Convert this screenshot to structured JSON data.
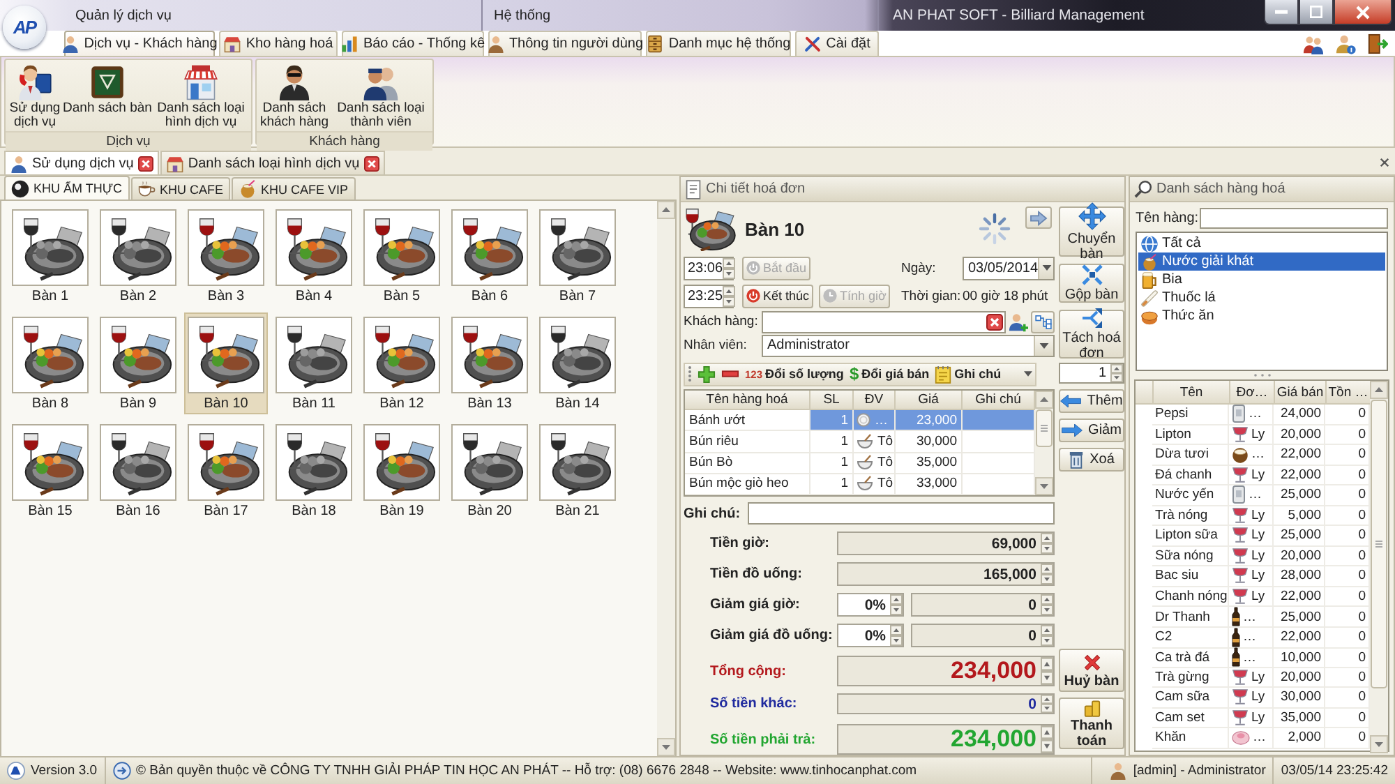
{
  "window": {
    "logo": "AP",
    "title": "AN PHAT SOFT - Billiard Management"
  },
  "tab_groups": [
    {
      "label": "Quản lý dịch vụ"
    },
    {
      "label": "Hệ thống"
    }
  ],
  "ribbon_tabs": [
    {
      "label": "Dịch vụ - Khách hàng",
      "selected": true
    },
    {
      "label": "Kho hàng hoá",
      "selected": false
    },
    {
      "label": "Báo cáo - Thống kê",
      "selected": false
    },
    {
      "label": "Thông tin người dùng",
      "selected": false
    },
    {
      "label": "Danh mục hệ thống",
      "selected": false
    },
    {
      "label": "Cài đặt",
      "selected": false
    }
  ],
  "ribbon_groups": [
    {
      "label": "Dịch vụ",
      "buttons": [
        "Sử dụng dịch vụ",
        "Danh sách bàn",
        "Danh sách loại hình dịch vụ"
      ]
    },
    {
      "label": "Khách hàng",
      "buttons": [
        "Danh sách khách hàng",
        "Danh sách loại thành viên"
      ]
    }
  ],
  "document_tabs": [
    {
      "label": "Sử dụng dịch vụ",
      "selected": true
    },
    {
      "label": "Danh sách loại hình dịch vụ",
      "selected": false
    }
  ],
  "area_tabs": [
    {
      "label": "KHU ẨM THỰC",
      "selected": true
    },
    {
      "label": "KHU CAFE",
      "selected": false
    },
    {
      "label": "KHU CAFE VIP",
      "selected": false
    }
  ],
  "tables": [
    {
      "name": "Bàn 1",
      "occupied": false,
      "selected": false
    },
    {
      "name": "Bàn 2",
      "occupied": false,
      "selected": false
    },
    {
      "name": "Bàn 3",
      "occupied": true,
      "selected": false
    },
    {
      "name": "Bàn 4",
      "occupied": true,
      "selected": false
    },
    {
      "name": "Bàn 5",
      "occupied": true,
      "selected": false
    },
    {
      "name": "Bàn 6",
      "occupied": true,
      "selected": false
    },
    {
      "name": "Bàn 7",
      "occupied": false,
      "selected": false
    },
    {
      "name": "Bàn 8",
      "occupied": true,
      "selected": false
    },
    {
      "name": "Bàn 9",
      "occupied": true,
      "selected": false
    },
    {
      "name": "Bàn 10",
      "occupied": true,
      "selected": true
    },
    {
      "name": "Bàn 11",
      "occupied": false,
      "selected": false
    },
    {
      "name": "Bàn 12",
      "occupied": true,
      "selected": false
    },
    {
      "name": "Bàn 13",
      "occupied": true,
      "selected": false
    },
    {
      "name": "Bàn 14",
      "occupied": false,
      "selected": false
    },
    {
      "name": "Bàn 15",
      "occupied": true,
      "selected": false
    },
    {
      "name": "Bàn 16",
      "occupied": false,
      "selected": false
    },
    {
      "name": "Bàn 17",
      "occupied": true,
      "selected": false
    },
    {
      "name": "Bàn 18",
      "occupied": false,
      "selected": false
    },
    {
      "name": "Bàn 19",
      "occupied": true,
      "selected": false
    },
    {
      "name": "Bàn 20",
      "occupied": false,
      "selected": false
    },
    {
      "name": "Bàn 21",
      "occupied": false,
      "selected": false
    }
  ],
  "invoice": {
    "title": "Chi tiết hoá đơn",
    "table": "Bàn 10",
    "start_time": "23:06",
    "start_button": {
      "label": "Bắt đầu",
      "disabled": true
    },
    "end_time": "23:25",
    "end_button": {
      "label": "Kết thúc",
      "disabled": false
    },
    "timer_button": {
      "label": "Tính giờ",
      "disabled": true
    },
    "date_label": "Ngày:",
    "date": "03/05/2014",
    "duration_label": "Thời gian:",
    "duration": "00 giờ 18 phút",
    "customer_label": "Khách hàng:",
    "staff_label": "Nhân viên:",
    "staff": "Administrator",
    "toolbar": [
      {
        "kind": "add"
      },
      {
        "kind": "remove"
      },
      {
        "kind": "quantity",
        "icon_text": "123",
        "label": "Đổi số lượng"
      },
      {
        "kind": "price",
        "icon_text": "$",
        "label": "Đổi giá bán"
      },
      {
        "kind": "note",
        "label": "Ghi chú"
      }
    ],
    "columns": [
      "Tên hàng hoá",
      "SL",
      "ĐV",
      "Giá",
      "Ghi chú"
    ],
    "items": [
      {
        "name": "Bánh ướt",
        "qty": "1",
        "kind": "plate",
        "unit": "…",
        "price": "23,000",
        "selected": true
      },
      {
        "name": "Bún riêu",
        "qty": "1",
        "kind": "bowl",
        "unit": "Tô",
        "price": "30,000",
        "selected": false
      },
      {
        "name": "Bún Bò",
        "qty": "1",
        "kind": "bowl",
        "unit": "Tô",
        "price": "35,000",
        "selected": false
      },
      {
        "name": "Bún mộc giò heo",
        "qty": "1",
        "kind": "bowl",
        "unit": "Tô",
        "price": "33,000",
        "selected": false
      }
    ],
    "note_label": "Ghi chú:",
    "totals": [
      {
        "kind": "amount",
        "label": "Tiền giờ:",
        "value": "69,000"
      },
      {
        "kind": "amount",
        "label": "Tiền đồ uống:",
        "value": "165,000"
      },
      {
        "kind": "discount",
        "label": "Giảm giá giờ:",
        "percent": "0%",
        "value": "0"
      },
      {
        "kind": "discount",
        "label": "Giảm giá đồ uống:",
        "percent": "0%",
        "value": "0"
      },
      {
        "kind": "grand",
        "label": "Tổng cộng:",
        "value": "234,000",
        "color": "#b3181c"
      },
      {
        "kind": "extra",
        "label": "Số tiền khác:",
        "value": "0",
        "color": "#1f2a9e"
      },
      {
        "kind": "grand",
        "label": "Số tiền phải trả:",
        "value": "234,000",
        "color": "#22a631"
      }
    ],
    "action_buttons": [
      "Chuyển bàn",
      "Gộp bàn",
      "Tách hoá đơn"
    ],
    "quantity": "1",
    "item_buttons": [
      "Thêm",
      "Giảm",
      "Xoá"
    ],
    "cancel_button": "Huỷ bàn",
    "pay_button": "Thanh toán"
  },
  "products": {
    "title": "Danh sách hàng hoá",
    "search_label": "Tên hàng:",
    "categories": [
      {
        "label": "Tất cả",
        "selected": false
      },
      {
        "label": "Nước giải khát",
        "selected": true
      },
      {
        "label": "Bia",
        "selected": false
      },
      {
        "label": "Thuốc lá",
        "selected": false
      },
      {
        "label": "Thức ăn",
        "selected": false
      }
    ],
    "columns": [
      "Tên",
      "Đơ…",
      "Giá bán",
      "Tồn …"
    ],
    "rows": [
      {
        "name": "Pepsi",
        "kind": "can",
        "unit": "…",
        "price": "24,000",
        "stock": "0"
      },
      {
        "name": "Lipton",
        "kind": "glass",
        "unit": "Ly",
        "price": "20,000",
        "stock": "0"
      },
      {
        "name": "Dừa tươi",
        "kind": "coconut",
        "unit": "…",
        "price": "22,000",
        "stock": "0"
      },
      {
        "name": "Đá chanh",
        "kind": "glass",
        "unit": "Ly",
        "price": "22,000",
        "stock": "0"
      },
      {
        "name": "Nước yến",
        "kind": "can",
        "unit": "…",
        "price": "25,000",
        "stock": "0"
      },
      {
        "name": "Trà nóng",
        "kind": "glass",
        "unit": "Ly",
        "price": "5,000",
        "stock": "0"
      },
      {
        "name": "Lipton sữa",
        "kind": "glass",
        "unit": "Ly",
        "price": "25,000",
        "stock": "0"
      },
      {
        "name": "Sữa nóng",
        "kind": "glass",
        "unit": "Ly",
        "price": "20,000",
        "stock": "0"
      },
      {
        "name": "Bac siu",
        "kind": "glass",
        "unit": "Ly",
        "price": "28,000",
        "stock": "0"
      },
      {
        "name": "Chanh nóng",
        "kind": "glass",
        "unit": "Ly",
        "price": "22,000",
        "stock": "0"
      },
      {
        "name": "Dr Thanh",
        "kind": "bottle",
        "unit": "…",
        "price": "25,000",
        "stock": "0"
      },
      {
        "name": "C2",
        "kind": "bottle",
        "unit": "…",
        "price": "22,000",
        "stock": "0"
      },
      {
        "name": "Ca trà đá",
        "kind": "bottle",
        "unit": "…",
        "price": "10,000",
        "stock": "0"
      },
      {
        "name": "Trà gừng",
        "kind": "glass",
        "unit": "Ly",
        "price": "20,000",
        "stock": "0"
      },
      {
        "name": "Cam sữa",
        "kind": "glass",
        "unit": "Ly",
        "price": "30,000",
        "stock": "0"
      },
      {
        "name": "Cam set",
        "kind": "glass",
        "unit": "Ly",
        "price": "35,000",
        "stock": "0"
      },
      {
        "name": "Khăn",
        "kind": "towel",
        "unit": "…",
        "price": "2,000",
        "stock": "0"
      }
    ]
  },
  "status_bar": {
    "version": "Version 3.0",
    "copyright": "© Bản quyền thuộc về CÔNG TY TNHH GIẢI PHÁP TIN HỌC AN PHÁT -- Hỗ trợ: (08) 6676 2848 -- Website: www.tinhocanphat.com",
    "user": "[admin] - Administrator",
    "datetime": "03/05/14 23:25:42"
  }
}
